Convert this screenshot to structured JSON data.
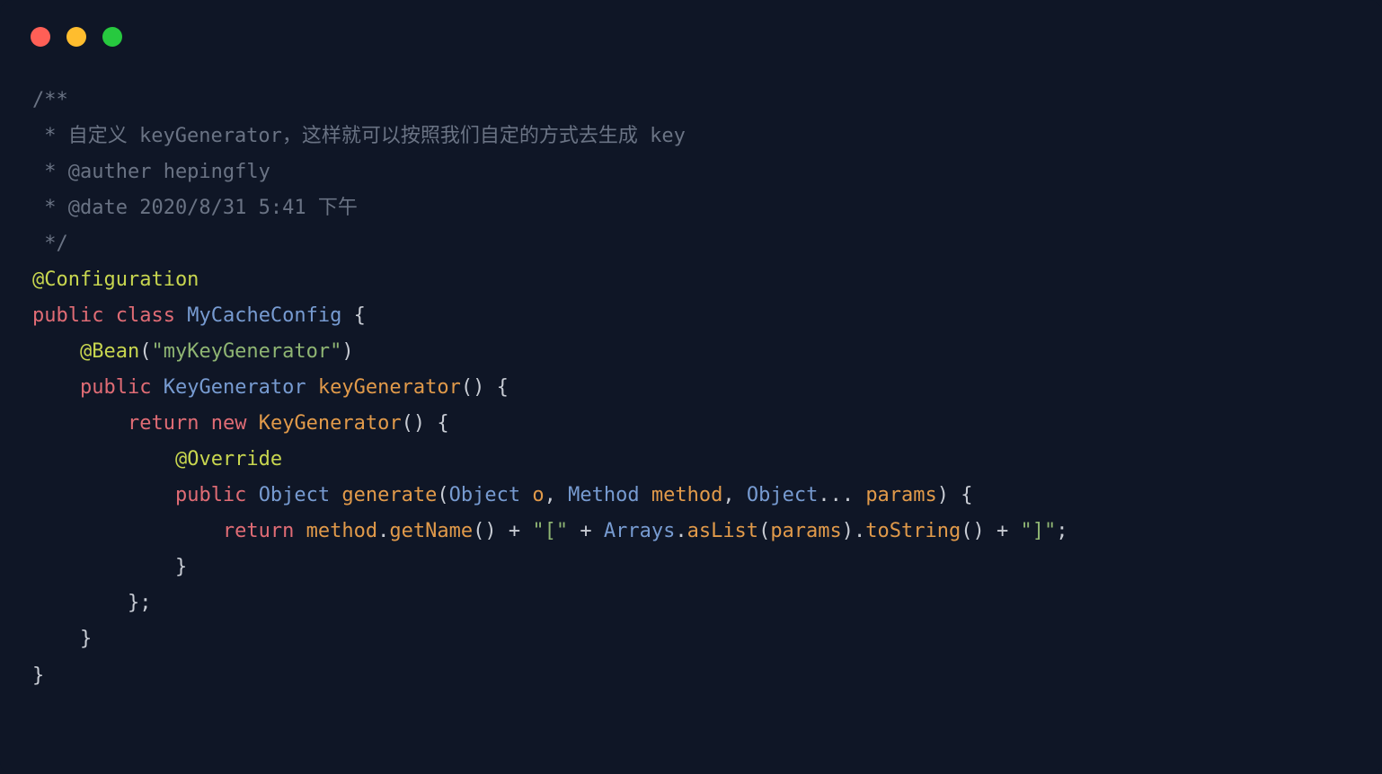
{
  "code": {
    "lines": [
      [
        {
          "cls": "tk-comment",
          "t": "/**"
        }
      ],
      [
        {
          "cls": "tk-comment",
          "t": " * 自定义 keyGenerator，这样就可以按照我们自定的方式去生成 key"
        }
      ],
      [
        {
          "cls": "tk-comment",
          "t": " * @auther hepingfly"
        }
      ],
      [
        {
          "cls": "tk-comment",
          "t": " * @date 2020/8/31 5:41 下午"
        }
      ],
      [
        {
          "cls": "tk-comment",
          "t": " */"
        }
      ],
      [
        {
          "cls": "tk-anno",
          "t": "@Configuration"
        }
      ],
      [
        {
          "cls": "tk-keyword",
          "t": "public"
        },
        {
          "cls": "tk-punct",
          "t": " "
        },
        {
          "cls": "tk-keyword",
          "t": "class"
        },
        {
          "cls": "tk-punct",
          "t": " "
        },
        {
          "cls": "tk-type",
          "t": "MyCacheConfig"
        },
        {
          "cls": "tk-punct",
          "t": " {"
        }
      ],
      [
        {
          "cls": "tk-punct",
          "t": "    "
        },
        {
          "cls": "tk-anno",
          "t": "@Bean"
        },
        {
          "cls": "tk-punct",
          "t": "("
        },
        {
          "cls": "tk-string",
          "t": "\"myKeyGenerator\""
        },
        {
          "cls": "tk-punct",
          "t": ")"
        }
      ],
      [
        {
          "cls": "tk-punct",
          "t": "    "
        },
        {
          "cls": "tk-keyword",
          "t": "public"
        },
        {
          "cls": "tk-punct",
          "t": " "
        },
        {
          "cls": "tk-type",
          "t": "KeyGenerator"
        },
        {
          "cls": "tk-punct",
          "t": " "
        },
        {
          "cls": "tk-method",
          "t": "keyGenerator"
        },
        {
          "cls": "tk-punct",
          "t": "() {"
        }
      ],
      [
        {
          "cls": "tk-punct",
          "t": "        "
        },
        {
          "cls": "tk-keyword",
          "t": "return"
        },
        {
          "cls": "tk-punct",
          "t": " "
        },
        {
          "cls": "tk-keyword",
          "t": "new"
        },
        {
          "cls": "tk-punct",
          "t": " "
        },
        {
          "cls": "tk-method",
          "t": "KeyGenerator"
        },
        {
          "cls": "tk-punct",
          "t": "() {"
        }
      ],
      [
        {
          "cls": "tk-punct",
          "t": "            "
        },
        {
          "cls": "tk-anno",
          "t": "@Override"
        }
      ],
      [
        {
          "cls": "tk-punct",
          "t": "            "
        },
        {
          "cls": "tk-keyword",
          "t": "public"
        },
        {
          "cls": "tk-punct",
          "t": " "
        },
        {
          "cls": "tk-type",
          "t": "Object"
        },
        {
          "cls": "tk-punct",
          "t": " "
        },
        {
          "cls": "tk-method",
          "t": "generate"
        },
        {
          "cls": "tk-punct",
          "t": "("
        },
        {
          "cls": "tk-type",
          "t": "Object"
        },
        {
          "cls": "tk-punct",
          "t": " "
        },
        {
          "cls": "tk-param",
          "t": "o"
        },
        {
          "cls": "tk-punct",
          "t": ", "
        },
        {
          "cls": "tk-type",
          "t": "Method"
        },
        {
          "cls": "tk-punct",
          "t": " "
        },
        {
          "cls": "tk-param",
          "t": "method"
        },
        {
          "cls": "tk-punct",
          "t": ", "
        },
        {
          "cls": "tk-type",
          "t": "Object"
        },
        {
          "cls": "tk-punct",
          "t": "... "
        },
        {
          "cls": "tk-param",
          "t": "params"
        },
        {
          "cls": "tk-punct",
          "t": ") {"
        }
      ],
      [
        {
          "cls": "tk-punct",
          "t": "                "
        },
        {
          "cls": "tk-keyword",
          "t": "return"
        },
        {
          "cls": "tk-punct",
          "t": " "
        },
        {
          "cls": "tk-param",
          "t": "method"
        },
        {
          "cls": "tk-punct",
          "t": "."
        },
        {
          "cls": "tk-method",
          "t": "getName"
        },
        {
          "cls": "tk-punct",
          "t": "() + "
        },
        {
          "cls": "tk-string",
          "t": "\"[\""
        },
        {
          "cls": "tk-punct",
          "t": " + "
        },
        {
          "cls": "tk-type",
          "t": "Arrays"
        },
        {
          "cls": "tk-punct",
          "t": "."
        },
        {
          "cls": "tk-method",
          "t": "asList"
        },
        {
          "cls": "tk-punct",
          "t": "("
        },
        {
          "cls": "tk-param",
          "t": "params"
        },
        {
          "cls": "tk-punct",
          "t": ")."
        },
        {
          "cls": "tk-method",
          "t": "toString"
        },
        {
          "cls": "tk-punct",
          "t": "() + "
        },
        {
          "cls": "tk-string",
          "t": "\"]\""
        },
        {
          "cls": "tk-punct",
          "t": ";"
        }
      ],
      [
        {
          "cls": "tk-punct",
          "t": "            }"
        }
      ],
      [
        {
          "cls": "tk-punct",
          "t": "        };"
        }
      ],
      [
        {
          "cls": "tk-punct",
          "t": "    }"
        }
      ],
      [
        {
          "cls": "tk-punct",
          "t": "}"
        }
      ]
    ]
  },
  "traffic": {
    "red": "close-icon",
    "yellow": "minimize-icon",
    "green": "maximize-icon"
  }
}
